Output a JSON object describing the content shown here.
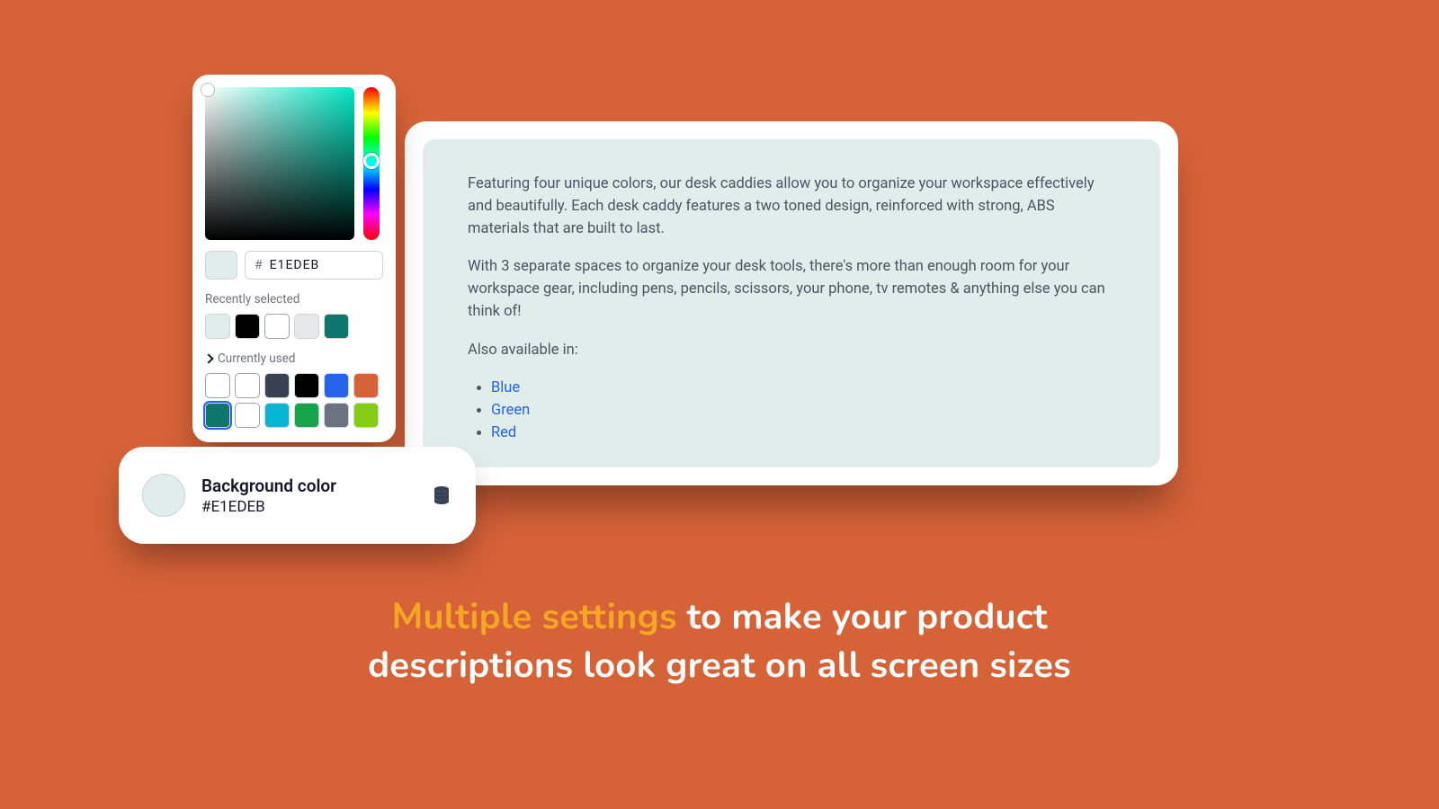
{
  "color_hex": "E1EDEB",
  "color_css": "#E1EDEB",
  "picker": {
    "recently_label": "Recently selected",
    "currently_label": "Currently used",
    "recent": [
      "#E1EDEB",
      "#000000",
      "#FFFFFF",
      "#E5E7EB",
      "#0F766E"
    ],
    "current": [
      "#FFFFFF",
      "#FFFFFF",
      "#374151",
      "#000000",
      "#2563EB",
      "#D66238",
      "#0F766E",
      "#FFFFFF",
      "#06B6D4",
      "#16A34A",
      "#6B7280",
      "#84CC16"
    ],
    "selected_index": 6
  },
  "setting": {
    "title": "Background color",
    "value": "#E1EDEB"
  },
  "preview": {
    "p1": "Featuring four unique colors, our desk caddies allow you to organize your workspace effectively and beautifully. Each desk caddy features a two toned design, reinforced with strong, ABS materials that are built to last.",
    "p2": "With 3 separate spaces to organize your desk tools, there's more than enough room for your workspace gear, including pens, pencils, scissors, your phone, tv remotes & anything else you can think of!",
    "also_label": "Also available in:",
    "links": [
      "Blue",
      "Green",
      "Red"
    ]
  },
  "tagline": {
    "highlight": "Multiple settings",
    "rest_line1": " to make your product",
    "line2": "descriptions look great on all screen sizes"
  }
}
